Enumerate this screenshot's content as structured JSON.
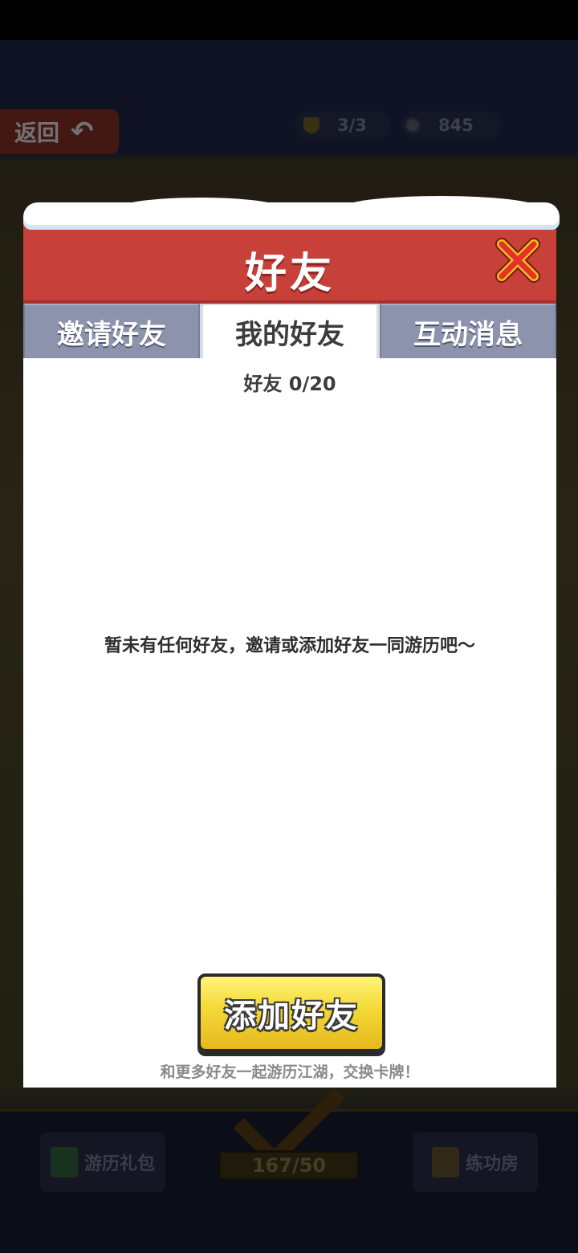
{
  "background": {
    "back_label": "返回",
    "stamina": "3/3",
    "coins": "845",
    "bottom_left_label": "游历礼包",
    "bottom_right_label": "练功房",
    "progress_text": "167/50"
  },
  "modal": {
    "title": "好友",
    "tabs": [
      {
        "label": "邀请好友",
        "active": false
      },
      {
        "label": "我的好友",
        "active": true
      },
      {
        "label": "互动消息",
        "active": false
      }
    ],
    "friend_count": "好友 0/20",
    "empty_message": "暂未有任何好友，邀请或添加好友一同游历吧～",
    "add_button_label": "添加好友",
    "footer_tip": "和更多好友一起游历江湖，交换卡牌！"
  },
  "colors": {
    "header_red": "#c8403a",
    "button_yellow": "#f3d936",
    "tab_inactive": "#8e93ad",
    "close_red": "#e8302a"
  }
}
